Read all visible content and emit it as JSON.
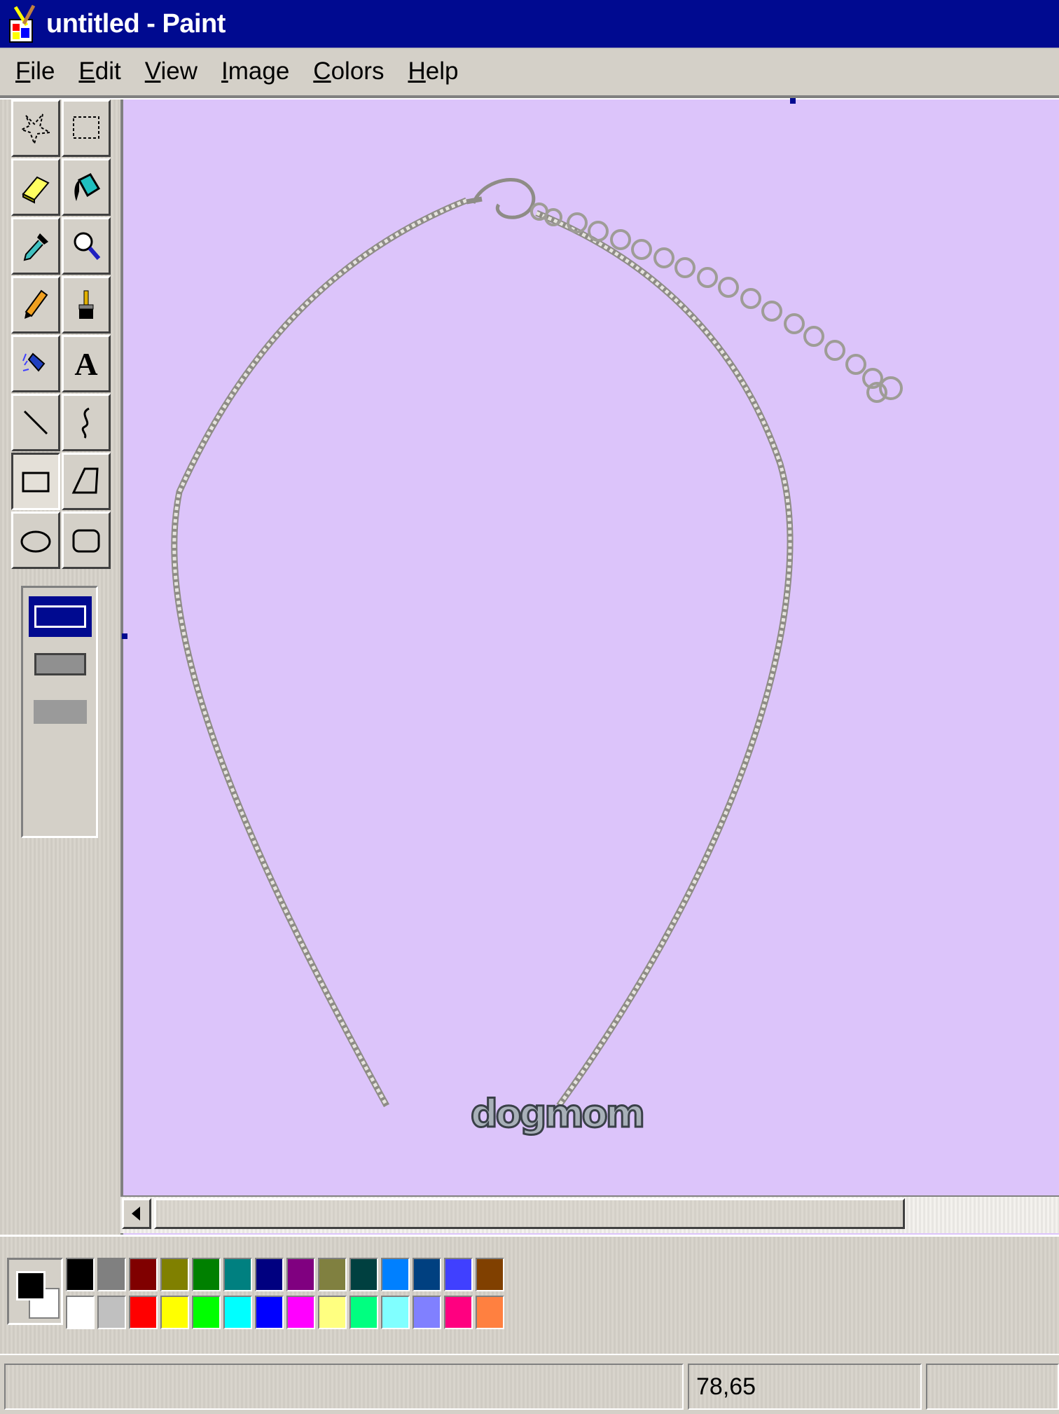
{
  "window": {
    "title": "untitled - Paint"
  },
  "menu": [
    {
      "label": "File",
      "mnemonic": "F",
      "rest": "ile"
    },
    {
      "label": "Edit",
      "mnemonic": "E",
      "rest": "dit"
    },
    {
      "label": "View",
      "mnemonic": "V",
      "rest": "iew"
    },
    {
      "label": "Image",
      "mnemonic": "I",
      "rest": "mage"
    },
    {
      "label": "Colors",
      "mnemonic": "C",
      "rest": "olors"
    },
    {
      "label": "Help",
      "mnemonic": "H",
      "rest": "elp"
    }
  ],
  "tools": [
    "free-form-select-icon",
    "select-icon",
    "eraser-icon",
    "fill-with-color-icon",
    "pick-color-icon",
    "magnifier-icon",
    "pencil-icon",
    "brush-icon",
    "airbrush-icon",
    "text-icon",
    "line-icon",
    "curve-icon",
    "rectangle-icon",
    "polygon-icon",
    "ellipse-icon",
    "rounded-rectangle-icon"
  ],
  "selected_tool": "rectangle-icon",
  "text_tool_glyph": "A",
  "fill_options": [
    "outline",
    "outline-and-fill",
    "fill-only"
  ],
  "selected_fill_option": "outline",
  "canvas": {
    "background_color": "#dcc4fa",
    "pendant_text": "dogmom"
  },
  "palette": {
    "foreground": "#000000",
    "background": "#ffffff",
    "row1": [
      "#000000",
      "#808080",
      "#800000",
      "#808000",
      "#008000",
      "#008080",
      "#000080",
      "#800080",
      "#808040",
      "#004040",
      "#0080ff",
      "#004080",
      "#4040ff",
      "#804000"
    ],
    "row2": [
      "#ffffff",
      "#c0c0c0",
      "#ff0000",
      "#ffff00",
      "#00ff00",
      "#00ffff",
      "#0000ff",
      "#ff00ff",
      "#ffff80",
      "#00ff80",
      "#80ffff",
      "#8080ff",
      "#ff0080",
      "#ff8040"
    ]
  },
  "status": {
    "message": "",
    "coordinates": "78,65",
    "size": ""
  }
}
